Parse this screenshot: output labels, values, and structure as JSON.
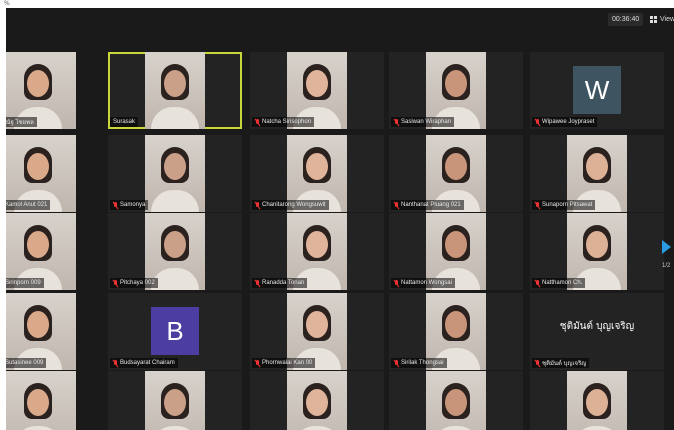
{
  "corner_mark": "%",
  "topbar": {
    "timer": "00:36:40",
    "view_label": "View"
  },
  "pager": {
    "indicator": "1/2"
  },
  "colors": {
    "background": "#1a1a1a",
    "tile": "#232323",
    "speaking_border": "#c8d83a",
    "mic_off": "#e33333",
    "avatar_w": "#3e5561",
    "avatar_b": "#4b3ea0",
    "arrow": "#2a9be0"
  },
  "participants": [
    {
      "label": "ณัฐ ไชยพล",
      "muted": false,
      "kind": "video",
      "speaking": false
    },
    {
      "label": "Surasak",
      "muted": false,
      "kind": "video",
      "speaking": true
    },
    {
      "label": "Natcha Sirisophon",
      "muted": true,
      "kind": "video",
      "speaking": false
    },
    {
      "label": "Sasiwan Wiraphan",
      "muted": true,
      "kind": "video",
      "speaking": false
    },
    {
      "label": "Wipawee Joypraset",
      "muted": true,
      "kind": "avatar",
      "avatar_letter": "W",
      "avatar_color": "#3e5561",
      "speaking": false
    },
    {
      "label": "Kamol Anut 021",
      "muted": false,
      "kind": "video",
      "speaking": false
    },
    {
      "label": "Samonya",
      "muted": true,
      "kind": "video",
      "speaking": false
    },
    {
      "label": "Chanitarong Wongsuwit",
      "muted": true,
      "kind": "video",
      "speaking": false
    },
    {
      "label": "Nanthanat Pluang 021",
      "muted": true,
      "kind": "video",
      "speaking": false
    },
    {
      "label": "Sunaporn Pitsawat",
      "muted": true,
      "kind": "video",
      "speaking": false
    },
    {
      "label": "Sirinporn 009",
      "muted": false,
      "kind": "video",
      "speaking": false
    },
    {
      "label": "Pitchaya 002",
      "muted": true,
      "kind": "video",
      "speaking": false
    },
    {
      "label": "Ranadda Tonan",
      "muted": true,
      "kind": "video",
      "speaking": false
    },
    {
      "label": "Nattamon Wongsai",
      "muted": true,
      "kind": "video",
      "speaking": false
    },
    {
      "label": "Natthamon Ch.",
      "muted": true,
      "kind": "video",
      "speaking": false
    },
    {
      "label": "Sutasinee 009",
      "muted": false,
      "kind": "video",
      "speaking": false
    },
    {
      "label": "Budsayarat Chairam",
      "muted": true,
      "kind": "avatar",
      "avatar_letter": "B",
      "avatar_color": "#4b3ea0",
      "speaking": false
    },
    {
      "label": "Phornwalai Kan 00",
      "muted": true,
      "kind": "video",
      "speaking": false
    },
    {
      "label": "Sirilak Thongsai",
      "muted": true,
      "kind": "video",
      "speaking": false
    },
    {
      "label": "ชุติมันต์ บุญเจริญ",
      "muted": true,
      "kind": "name",
      "display_name": "ชุติมันต์ บุญเจริญ",
      "speaking": false
    },
    {
      "label": "",
      "muted": false,
      "kind": "video",
      "speaking": false
    },
    {
      "label": "",
      "muted": false,
      "kind": "video",
      "speaking": false
    },
    {
      "label": "",
      "muted": false,
      "kind": "video",
      "speaking": false
    },
    {
      "label": "",
      "muted": false,
      "kind": "video",
      "speaking": false
    },
    {
      "label": "",
      "muted": false,
      "kind": "video",
      "speaking": false
    }
  ]
}
